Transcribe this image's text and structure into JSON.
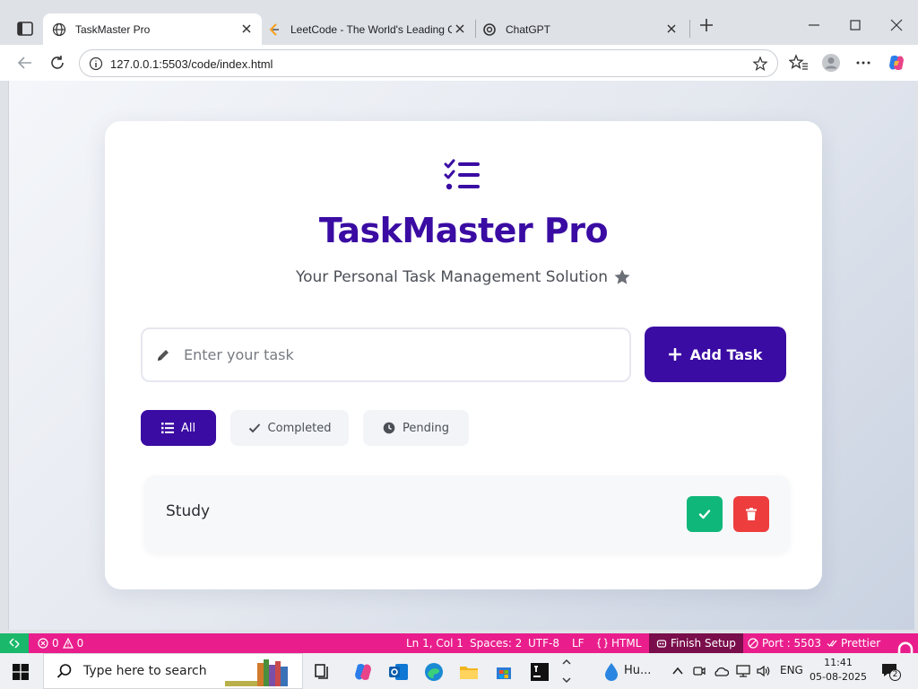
{
  "browser": {
    "tabs": [
      {
        "label": "TaskMaster Pro",
        "active": true
      },
      {
        "label": "LeetCode - The World's Leading O",
        "active": false
      },
      {
        "label": "ChatGPT",
        "active": false
      }
    ],
    "url": "127.0.0.1:5503/code/index.html"
  },
  "app": {
    "title": "TaskMaster Pro",
    "subtitle": "Your Personal Task Management Solution",
    "input_placeholder": "Enter your task",
    "add_button": "Add Task",
    "filters": {
      "all": "All",
      "completed": "Completed",
      "pending": "Pending"
    },
    "active_filter": "All",
    "tasks": [
      {
        "text": "Study"
      }
    ],
    "accent_color": "#3a0ca3",
    "complete_color": "#10b77a",
    "delete_color": "#ee3d3d"
  },
  "statusbar": {
    "problems_errors": "0",
    "problems_warnings": "0",
    "cursor": "Ln 1, Col 1",
    "spaces": "Spaces: 2",
    "encoding": "UTF-8",
    "eol": "LF",
    "language": "HTML",
    "finish_setup": "Finish Setup",
    "port": "Port : 5503",
    "prettier": "Prettier",
    "bg_color": "#e91e8c"
  },
  "taskbar": {
    "search_placeholder": "Type here to search",
    "weather_label": "Hu...",
    "language": "ENG",
    "time": "11:41",
    "date": "05-08-2025",
    "notifications": "2"
  }
}
